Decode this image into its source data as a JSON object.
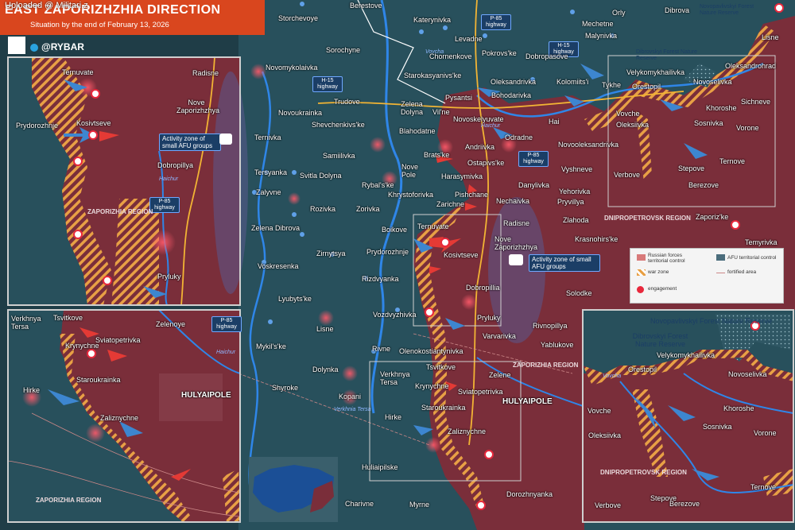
{
  "header": {
    "title": "EAST ZAPORIZHZHIA DIRECTION",
    "subtitle": "Situation by the end of February 13, 2026",
    "uploaded": "Uploaded @ Militari.z",
    "brand": "@RYBAR",
    "title_color": "#d9461e"
  },
  "legend": {
    "russian": "Russian forces territorial control",
    "afu": "AFU territorial control",
    "war_zone": "war zone",
    "fortified": "fortified area",
    "engagement": "engagement"
  },
  "highways": {
    "p85": "P-85 highway",
    "h15": "H-15 highway"
  },
  "regions": {
    "zaporizhzhia": "ZAPORIZHIA REGION",
    "dnipropetrovsk": "DNIPROPETROVSK REGION"
  },
  "activity_zone": "Activity zone of small AFU groups",
  "water": {
    "haichur": "Haichur",
    "vovcha": "Vovcha",
    "verkhnia_tersa": "Verkhnia Tersa"
  },
  "places_main": {
    "berestove": "Berestove",
    "storchevoye": "Storchevoye",
    "katerynivka": "Katerynivka",
    "levadne": "Levadne",
    "sorochyne": "Sorochyne",
    "novomykolaivka": "Novomykolaivka",
    "chornenkove": "Chornenkove",
    "pokrovske": "Pokrovs'ke",
    "dobropasove": "Dobropasove",
    "mechetne": "Mechetne",
    "malynivka": "Malynivka",
    "orly": "Orly",
    "dibrova": "Dibrova",
    "novopavlivskyi_top": "Novopavlivskyi Forest Nature Reserve",
    "lisne_ne": "Lisne",
    "oleksandrohrad": "Oleksandrohrad",
    "starokasyanivske": "Starokasyanivs'ke",
    "oleksandrivka": "Oleksandrivka",
    "kolomiitsi": "Kolomiits'i",
    "dibrovskyi": "Dibrovskyi Forest Nature Reserve",
    "velykomykhailivka": "Velykomykhailivka",
    "novoselivka": "Novoselivka",
    "trudove": "Trudove",
    "zelena_dolyna": "Zelena Dolyna",
    "vilne": "Vil'ne",
    "pysantsi": "Pysantsi",
    "bohodarivka": "Bohodarivka",
    "tykhe": "Tykhe",
    "orestopil": "Orestopil",
    "khoroshe": "Khoroshe",
    "sichneve": "Sichneve",
    "novoukrainka": "Novoukrainka",
    "shevchenkivske": "Shevchenkivs'ke",
    "blahodatne": "Blahodatne",
    "novoskelyuvate": "Novoskelyuvate",
    "hai": "Hai",
    "vovche": "Vovche",
    "sosnivka": "Sosnivka",
    "vorone": "Vorone",
    "oleksiivka": "Oleksiivka",
    "ternivka": "Ternivka",
    "odradne": "Odradne",
    "andriivka": "Andriivka",
    "novooleksandrivka": "Novooleksandrivka",
    "bratske": "Brats'ke",
    "ostapivske": "Ostapivs'ke",
    "samiilivka": "Samiilivka",
    "tersyanka": "Tersyanka",
    "svitla_dolyna": "Svitla Dolyna",
    "nove_pole": "Nove Pole",
    "harasymivka": "Harasymivka",
    "vyshneve": "Vyshneve",
    "verbove": "Verbove",
    "stepove": "Stepove",
    "ternove": "Ternove",
    "rybalske": "Rybal's'ke",
    "khrystoforivka": "Khrystoforivka",
    "pishchane": "Pishchane",
    "danylivka": "Danylivka",
    "yehorivka": "Yehorivka",
    "berezove": "Berezove",
    "zalyvne": "Zalyvne",
    "zorivka": "Zorivka",
    "rozivka": "Rozivka",
    "zarichne": "Zarichne",
    "nechaivka": "Nechaivka",
    "pryvillya": "Pryvillya",
    "zaporizke": "Zaporiz'ke",
    "zlahoda": "Zlahoda",
    "boikove": "Boikove",
    "zelena_dibrova": "Zelena Dibrova",
    "radisne": "Radisne",
    "krasnohirske": "Krasnohirs'ke",
    "temyrivka": "Temyrivka",
    "ternuvate": "Ternuvate",
    "nove_zaporizhzhya": "Nove Zaporizhzhya",
    "zirnytsya": "Zirnytsya",
    "prydorozhnje": "Prydorozhnje",
    "kosivtseve": "Kosivtseve",
    "voskresenka": "Voskresenka",
    "dobropillia": "Dobropillia",
    "rizdvyanka": "Rizdvyanka",
    "solodke": "Solodke",
    "lyubytske": "Lyubyts'ke",
    "vozdvyzhivka": "Vozdvyzhivka",
    "pryluky": "Pryluky",
    "lisne": "Lisne",
    "rivnopillya": "Rivnopillya",
    "varvarivka": "Varvarivka",
    "mykilske": "Mykil's'ke",
    "yablukove": "Yablukove",
    "rivne": "Rivne",
    "olenokostiantynivka": "Olenokostiantynivka",
    "dolynka": "Dolynka",
    "tsvitkove": "Tsvitkove",
    "zelene": "Zelene",
    "verkhnya_tersa": "Verkhnya Tersa",
    "krynychne": "Krynychne",
    "shyroke": "Shyroke",
    "kopani": "Kopani",
    "sviatopetrivka": "Sviatopetrivka",
    "staroukrainka": "Staroukrainka",
    "hulyaipole": "HULYAIPOLE",
    "hirke": "Hirke",
    "zaliznychne": "Zaliznychne",
    "huliaipilske": "Huliaipilske",
    "dorozhnyanka": "Dorozhnyanka",
    "charivne": "Charivne",
    "myrne": "Myrne"
  },
  "places_inset1": {
    "ternuvate": "Ternuvate",
    "radisne": "Radisne",
    "nove_zap": "Nove Zaporizhzhya",
    "prydorozhnje": "Prydorozhnje",
    "kosivtseve": "Kosivtseve",
    "dobropillya": "Dobropillya",
    "pryluky": "Pryluky"
  },
  "places_inset2": {
    "verkhnya_tersa": "Verkhnya Tersa",
    "tsvitkove": "Tsvitkove",
    "zelenoye": "Zelenoye",
    "krynychne": "Krynychne",
    "sviatopetrivka": "Sviatopetrivka",
    "staroukrainka": "Staroukrainka",
    "hirke": "Hirke",
    "hulyaipole": "HULYAIPOLE",
    "zaliznychne": "Zaliznychne"
  },
  "places_inset3": {
    "novopavlivskyi": "Novopavlivskyi Forest Nature Reserve",
    "dibrovskyi": "Dibrovskyi Forest Nature Reserve",
    "velykomykhailivka": "Velykomykhailivka",
    "orestopil": "Orestopil",
    "novoselivka": "Novoselivka",
    "vovcha": "Vovcha",
    "vovche": "Vovche",
    "khoroshe": "Khoroshe",
    "oleksiivka": "Oleksiivka",
    "sosnivka": "Sosnivka",
    "vorone": "Vorone",
    "stepove": "Stepove",
    "ternove": "Ternove",
    "verbove": "Verbove",
    "berezove": "Berezove"
  },
  "colors": {
    "russian_area": "#7a2e3a",
    "afu_area": "#28505c",
    "war_zone": "#e8a045",
    "engagement": "#e8283c",
    "arrow_ru": "#e43a35",
    "arrow_afu": "#3d86d0"
  }
}
